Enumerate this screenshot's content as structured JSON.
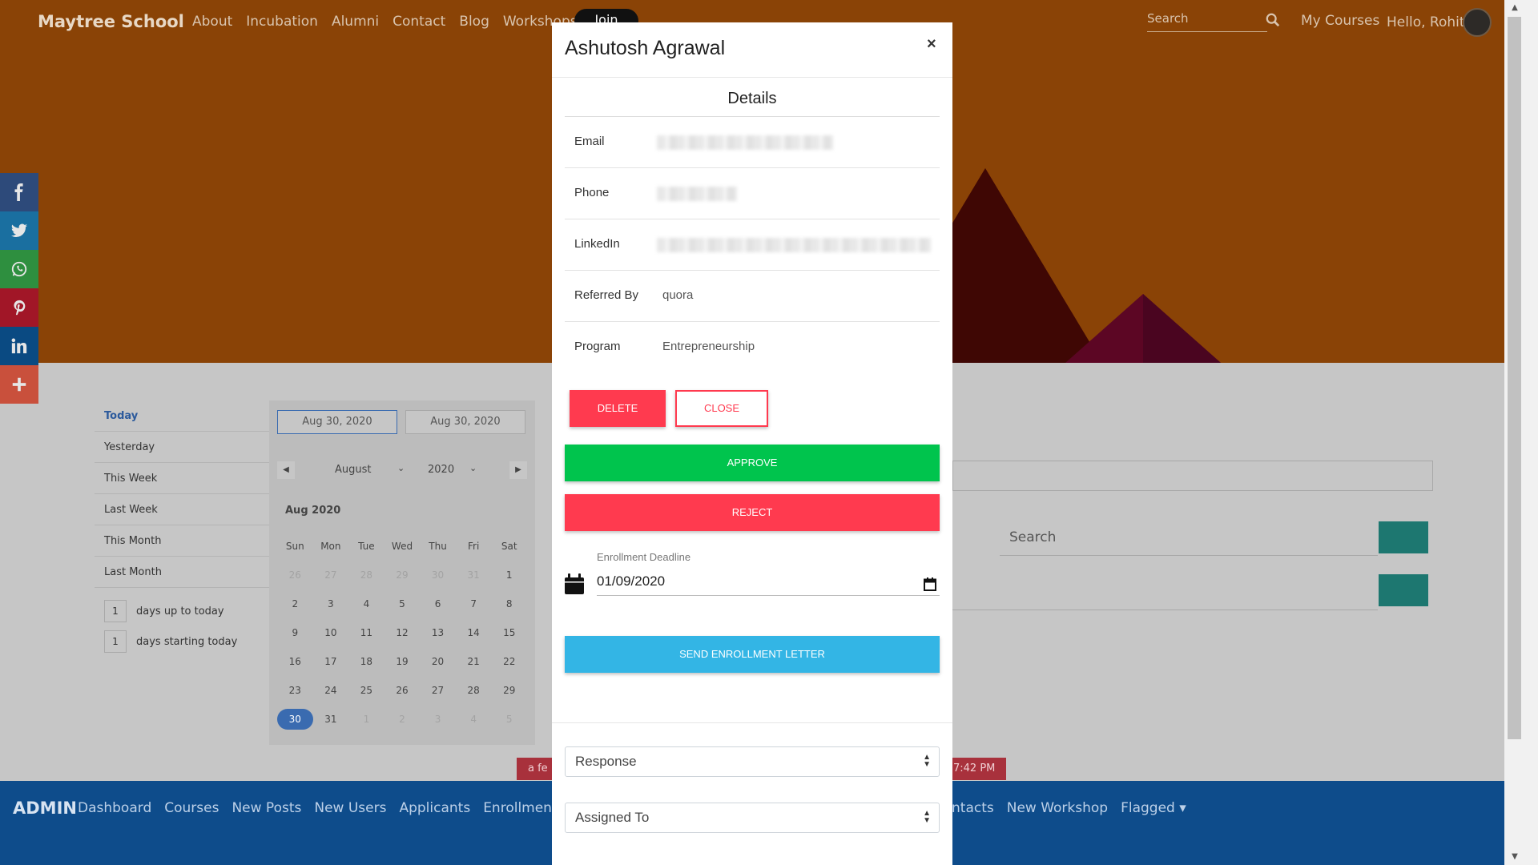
{
  "site": {
    "brand": "Maytree School",
    "nav_links": [
      "About",
      "Incubation",
      "Alumni",
      "Contact",
      "Blog",
      "Workshops"
    ],
    "join_label": "Join",
    "search_placeholder": "Search",
    "my_courses": "My Courses",
    "greeting": "Hello, Rohit"
  },
  "share_bar": [
    {
      "icon": "facebook-icon",
      "color": "#2d4a7a"
    },
    {
      "icon": "twitter-icon",
      "color": "#1a6fa0"
    },
    {
      "icon": "whatsapp-icon",
      "color": "#2e8f3f"
    },
    {
      "icon": "pinterest-icon",
      "color": "#a11627"
    },
    {
      "icon": "linkedin-icon",
      "color": "#0a4a82"
    },
    {
      "icon": "plus-icon",
      "color": "#c9503c"
    }
  ],
  "date_picker": {
    "ranges": [
      "Today",
      "Yesterday",
      "This Week",
      "Last Week",
      "This Month",
      "Last Month"
    ],
    "days_up_value": "1",
    "days_up_label": "days up to today",
    "days_start_value": "1",
    "days_start_label": "days starting today",
    "start_date": "Aug 30, 2020",
    "end_date": "Aug 30, 2020",
    "month_select": "August",
    "year_select": "2020",
    "month_title": "Aug 2020",
    "weekdays": [
      "Sun",
      "Mon",
      "Tue",
      "Wed",
      "Thu",
      "Fri",
      "Sat"
    ],
    "days": [
      {
        "d": "26",
        "muted": true
      },
      {
        "d": "27",
        "muted": true
      },
      {
        "d": "28",
        "muted": true
      },
      {
        "d": "29",
        "muted": true
      },
      {
        "d": "30",
        "muted": true
      },
      {
        "d": "31",
        "muted": true
      },
      {
        "d": "1"
      },
      {
        "d": "2"
      },
      {
        "d": "3"
      },
      {
        "d": "4"
      },
      {
        "d": "5"
      },
      {
        "d": "6"
      },
      {
        "d": "7"
      },
      {
        "d": "8"
      },
      {
        "d": "9"
      },
      {
        "d": "10"
      },
      {
        "d": "11"
      },
      {
        "d": "12"
      },
      {
        "d": "13"
      },
      {
        "d": "14"
      },
      {
        "d": "15"
      },
      {
        "d": "16"
      },
      {
        "d": "17"
      },
      {
        "d": "18"
      },
      {
        "d": "19"
      },
      {
        "d": "20"
      },
      {
        "d": "21"
      },
      {
        "d": "22"
      },
      {
        "d": "23"
      },
      {
        "d": "24"
      },
      {
        "d": "25"
      },
      {
        "d": "26"
      },
      {
        "d": "27"
      },
      {
        "d": "28"
      },
      {
        "d": "29"
      },
      {
        "d": "30",
        "selected": true
      },
      {
        "d": "31"
      },
      {
        "d": "1",
        "muted": true
      },
      {
        "d": "2",
        "muted": true
      },
      {
        "d": "3",
        "muted": true
      },
      {
        "d": "4",
        "muted": true
      },
      {
        "d": "5",
        "muted": true
      }
    ]
  },
  "background": {
    "search_placeholder": "Search",
    "pill_left": "a fe",
    "pill_right": "7:42 PM"
  },
  "admin_bar": {
    "brand": "ADMIN",
    "links_left": [
      "Dashboard",
      "Courses",
      "New Posts",
      "New Users",
      "Applicants",
      "Enrollments"
    ],
    "links_right": [
      "ntacts",
      "New Workshop",
      "Flagged ▾"
    ]
  },
  "modal": {
    "title": "Ashutosh Agrawal",
    "close_symbol": "×",
    "section_title": "Details",
    "rows": {
      "email_label": "Email",
      "phone_label": "Phone",
      "linkedin_label": "LinkedIn",
      "referred_label": "Referred By",
      "referred_value": "quora",
      "program_label": "Program",
      "program_value": "Entrepreneurship"
    },
    "delete_label": "DELETE",
    "close_label": "CLOSE",
    "approve_label": "APPROVE",
    "reject_label": "REJECT",
    "deadline_label": "Enrollment Deadline",
    "deadline_value": "01/09/2020",
    "send_label": "SEND ENROLLMENT LETTER",
    "response_select": "Response",
    "assigned_select": "Assigned To"
  },
  "colors": {
    "hero": "#8a4306",
    "admin_bar": "#0e4c8b",
    "approve": "#00c44d",
    "reject": "#ff3a4f",
    "send": "#33b5e5"
  }
}
